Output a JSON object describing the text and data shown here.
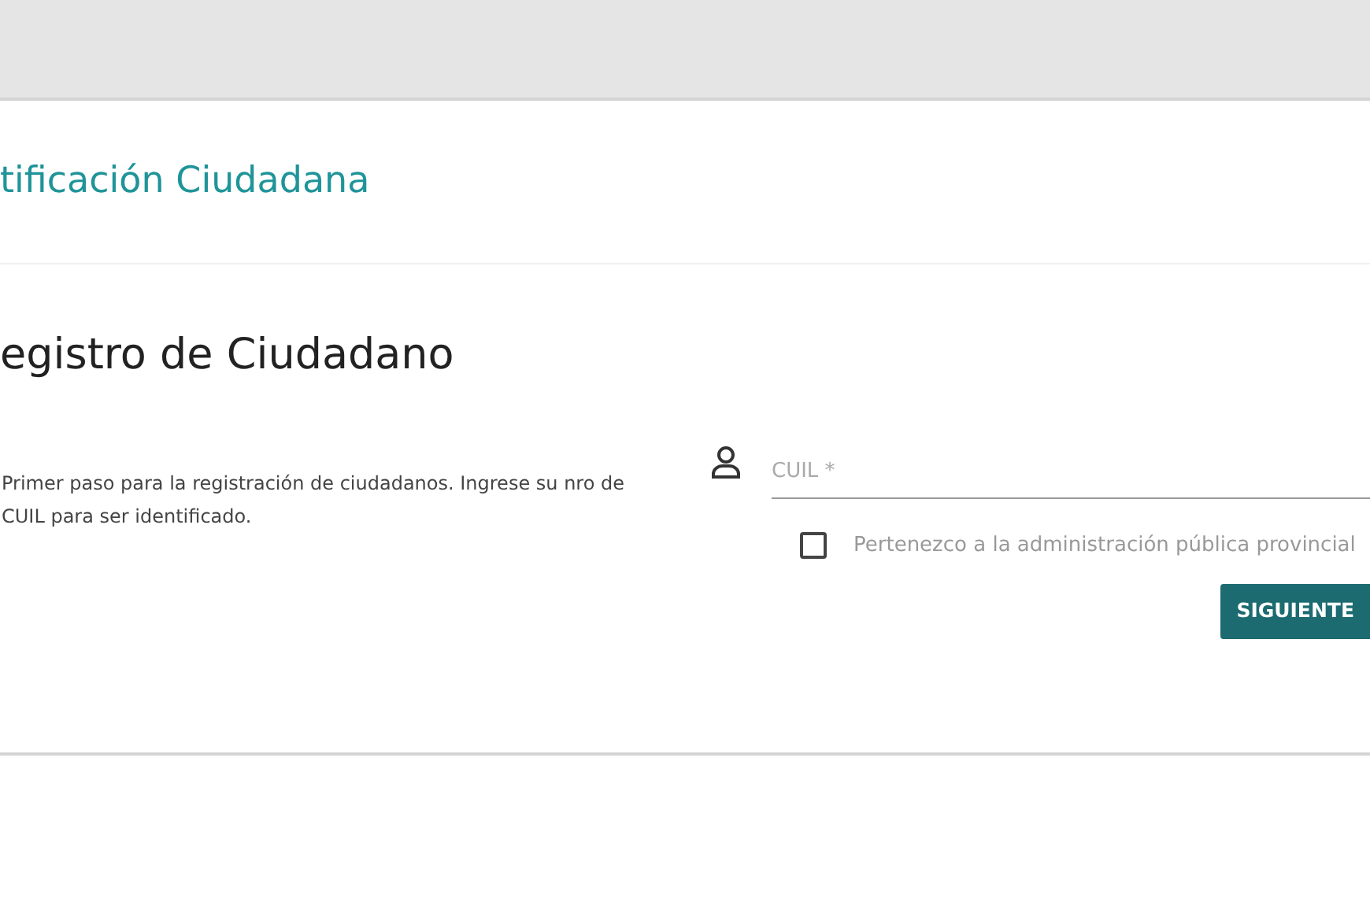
{
  "header": {
    "title": "tificación Ciudadana"
  },
  "form": {
    "heading": "egistro de Ciudadano",
    "description": "Primer paso para la registración de ciudadanos. Ingrese su nro de CUIL para ser identificado.",
    "cuil_field": {
      "placeholder": "CUIL *"
    },
    "checkbox": {
      "label": "Pertenezco a la administración pública provincial",
      "checked": false
    },
    "button": "SIGUIENTE"
  }
}
